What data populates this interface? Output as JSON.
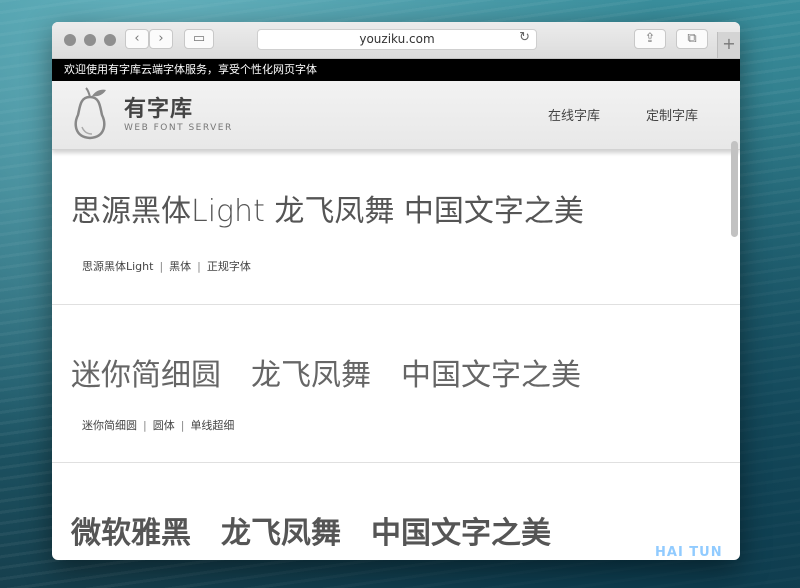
{
  "browser": {
    "url": "youziku.com",
    "back_icon": "‹",
    "forward_icon": "›",
    "sidebar_icon": "▭",
    "reload_icon": "↻",
    "share_icon": "⇪",
    "tabs_icon": "⧉",
    "new_tab_icon": "+"
  },
  "site": {
    "welcome": "欢迎使用有字库云端字体服务，享受个性化网页字体",
    "logo_title": "有字库",
    "logo_subtitle": "WEB FONT SERVER",
    "nav": [
      "在线字库",
      "定制字库"
    ]
  },
  "fonts": [
    {
      "sample": [
        "思源黑体Light 龙飞凤舞 中国文字之美"
      ],
      "tags": [
        "思源黑体Light",
        "黑体",
        "正规字体"
      ]
    },
    {
      "sample": [
        "迷你简细圆",
        "龙飞凤舞",
        "中国文字之美"
      ],
      "tags": [
        "迷你简细圆",
        "圆体",
        "单线超细"
      ]
    },
    {
      "sample": [
        "微软雅黑",
        "龙飞凤舞",
        "中国文字之美"
      ],
      "tags": []
    }
  ],
  "colors": {
    "topbar": "#000000",
    "header": "#eeeeee",
    "sample_text": "#555555"
  },
  "watermark": "HAI TUN"
}
